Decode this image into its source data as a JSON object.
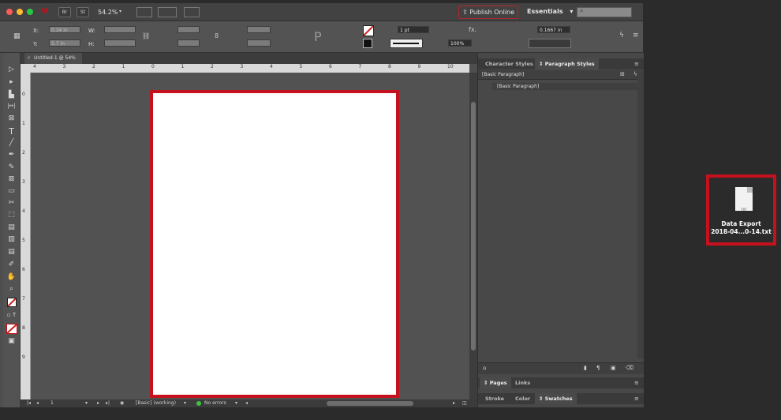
{
  "appbar": {
    "zoom": "54.2%",
    "publish_label": "Publish Online",
    "workspace_label": "Essentials",
    "workspace_chevron": "▾",
    "btn_br": "Br",
    "btn_st": "St",
    "app_badge": "Id"
  },
  "control": {
    "x_label": "X:",
    "y_label": "Y:",
    "w_label": "W:",
    "h_label": "H:",
    "x_value": "0.34 in",
    "y_value": "5.7 in",
    "stroke_weight": "1 pt",
    "opacity": "100%",
    "offset_value": "0.1667 in",
    "fx_label": "fx."
  },
  "document": {
    "tab_label": "Untitled-1 @ 54%",
    "ruler_h": [
      "4",
      "3",
      "2",
      "1",
      "0",
      "1",
      "2",
      "3",
      "4",
      "5",
      "6",
      "7",
      "8",
      "9",
      "10"
    ],
    "ruler_v": [
      "0",
      "1",
      "2",
      "3",
      "4",
      "5",
      "6",
      "7",
      "8",
      "9"
    ]
  },
  "statusbar": {
    "page_number": "1",
    "style_state": "[Basic] (working)",
    "errors": "No errors"
  },
  "panels": {
    "tab_character_styles": "Character Styles",
    "tab_paragraph_styles": "Paragraph Styles",
    "active_style": "[Basic Paragraph]",
    "list_item": "[Basic Paragraph]",
    "bottom_tabs_1": [
      "Pages",
      "Links"
    ],
    "bottom_tabs_2": [
      "Stroke",
      "Color",
      "Swatches"
    ]
  },
  "desktop_file": {
    "name_line1": "Data Export",
    "name_line2": "2018-04...0-14.txt",
    "ext": "TXT"
  },
  "colors": {
    "highlight_red": "#c4111d",
    "traffic_close": "#fc5d56",
    "traffic_min": "#fdbb2f",
    "traffic_max": "#28c840"
  }
}
